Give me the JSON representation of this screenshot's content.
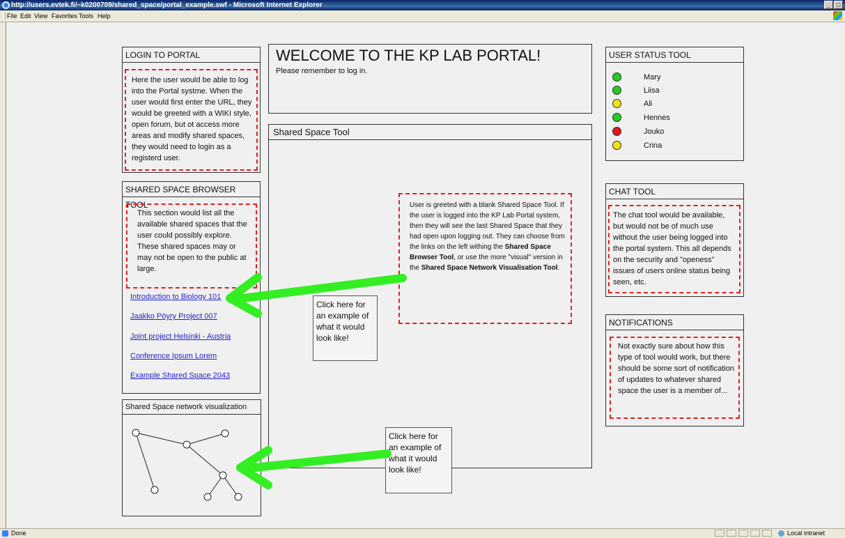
{
  "window": {
    "title": "http://users.evtek.fi/~k0200709/shared_space/portal_example.swf - Microsoft Internet Explorer",
    "controls": [
      "_",
      "□"
    ]
  },
  "menu": [
    "File",
    "Edit",
    "View",
    "Favorites",
    "Tools",
    "Help"
  ],
  "login": {
    "title": "LOGIN TO PORTAL",
    "text": "Here the user would be able to log into the Portal systme. When the user would first enter the URL, they would be greeted with a WIKI style, open forum, but ot access more areas and modify shared spaces, they would need to login as a registerd user."
  },
  "welcome": {
    "title": "WELCOME TO THE KP LAB PORTAL!",
    "subtitle": "Please remember to log in."
  },
  "browser": {
    "title": "SHARED SPACE BROWSER TOOL",
    "text": "This section would list all the available shared spaces that the user could possibly explore. These shared spaces may or may not be open to the public at large.",
    "links": [
      "Introduction to Biology 101",
      "Jaakko Pöyry Project 007",
      "Joint project Helsinki - Austria",
      "Conference Ipsum Lorem",
      "Example Shared Space 2043"
    ]
  },
  "shared_space": {
    "title": "Shared Space Tool",
    "note_part1": "User is greeted with a blank Shared Space Tool. If the user is logged into the KP Lab Portal system, then they will see the last Shared Space that they had open upon logging out. They can choose from the links on the left withing the ",
    "note_bold1": "Shared Space Browser Tool",
    "note_part2": ", or use the more \"visual\" version in the ",
    "note_bold2": "Shared Space Network Visualisation Tool",
    "note_part3": "."
  },
  "callouts": {
    "browser_example": "Click here for an example of what it would look like!",
    "network_example": "Click here for an example of what it would look like!"
  },
  "network": {
    "title": "Shared Space network visualization"
  },
  "user_status": {
    "title": "USER STATUS TOOL",
    "users": [
      {
        "name": "Mary",
        "color": "#22cc22"
      },
      {
        "name": "Liisa",
        "color": "#22cc22"
      },
      {
        "name": "Ali",
        "color": "#f2e01a"
      },
      {
        "name": "Hennes",
        "color": "#22cc22"
      },
      {
        "name": "Jouko",
        "color": "#e01818"
      },
      {
        "name": "Crina",
        "color": "#f2e01a"
      }
    ]
  },
  "chat": {
    "title": "CHAT TOOL",
    "text": "The chat tool would be available, but would not be of much use without the user being logged into the portal system. This all depends on the security and \"openess\" issues of users online status being seen, etc."
  },
  "notifications": {
    "title": "NOTIFICATIONS",
    "text": "Not exactly sure about how this type of tool would work, but there should be some sort of notification of updates to whatever shared space the user is a member of..."
  },
  "statusbar": {
    "left": "Done",
    "zone": "Local intranet"
  },
  "colors": {
    "dashed_border": "#e02020",
    "arrow": "#33ee22",
    "link": "#2222cc"
  }
}
